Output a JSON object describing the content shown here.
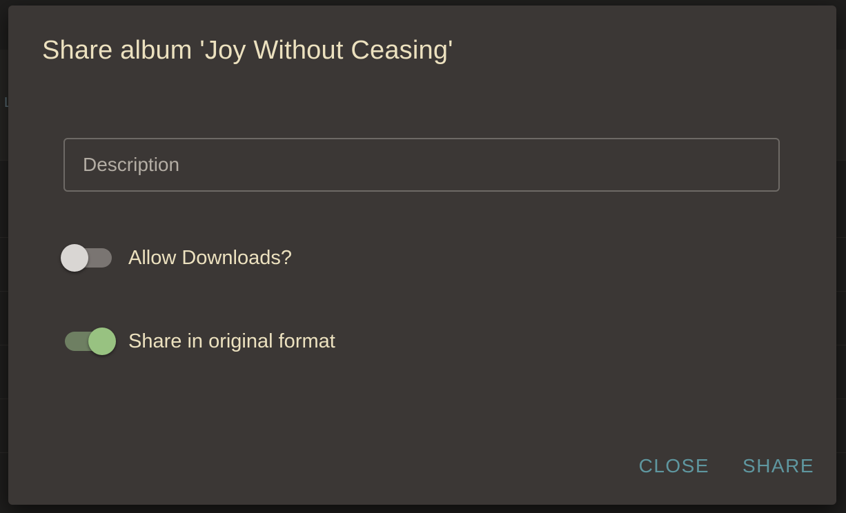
{
  "dialog": {
    "title": "Share album 'Joy Without Ceasing'",
    "description": {
      "placeholder": "Description",
      "value": ""
    },
    "toggles": [
      {
        "label": "Allow Downloads?",
        "checked": false
      },
      {
        "label": "Share in original format",
        "checked": true
      }
    ],
    "actions": {
      "close_label": "CLOSE",
      "share_label": "SHARE"
    }
  },
  "background": {
    "stub_text": "L"
  },
  "colors": {
    "dialog_bg": "#3b3735",
    "text": "#ece1bf",
    "accent_button": "#5f97a0",
    "toggle_on": "#98c281",
    "toggle_off_thumb": "#d9d6d3"
  }
}
